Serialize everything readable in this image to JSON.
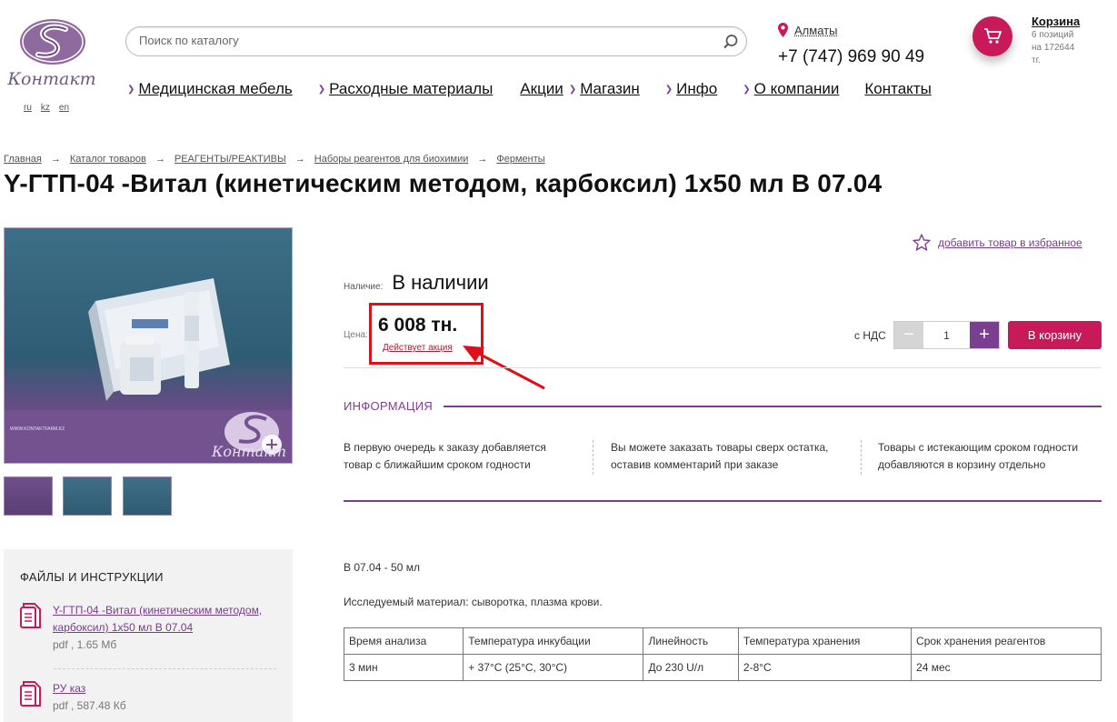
{
  "brand": {
    "logo_text": "Контакт",
    "accent": "#7b3f8f",
    "pink": "#c8195a"
  },
  "langs": [
    "ru",
    "kz",
    "en"
  ],
  "search": {
    "placeholder": "Поиск по каталогу",
    "icon": "search-icon"
  },
  "city": "Алматы",
  "phone": "+7 (747) 969 90 49",
  "cart": {
    "title": "Корзина",
    "line1": "6 позиций",
    "line2": "на 172644",
    "line3": "тг."
  },
  "nav": [
    {
      "label": "Медицинская мебель",
      "chevron": true
    },
    {
      "label": "Расходные материалы",
      "chevron": true
    },
    {
      "label": "Акции",
      "chevron": false
    },
    {
      "label": "Магазин",
      "chevron": true
    },
    {
      "label": "Инфо",
      "chevron": true
    },
    {
      "label": "О компании",
      "chevron": true
    },
    {
      "label": "Контакты",
      "chevron": false
    }
  ],
  "breadcrumbs": [
    "Главная",
    "Каталог товаров",
    "РЕАГЕНТЫ/РЕАКТИВЫ",
    "Наборы реагентов для биохимии",
    "Ферменты"
  ],
  "product": {
    "title": "Y-ГТП-04 -Витал (кинетическим методом, карбоксил) 1x50 мл В 07.04",
    "favorite": "добавить товар в избранное",
    "availability_label": "Наличие:",
    "availability": "В наличии",
    "price_label": "Цена:",
    "price": "6 008 тн.",
    "promo": "Действует акция",
    "vat": "с НДС",
    "qty": "1",
    "minus": "−",
    "plus": "+",
    "buy": "В корзину"
  },
  "info": {
    "heading": "ИНФОРМАЦИЯ",
    "notes": [
      {
        "l1": "В первую очередь к заказу добавляется",
        "l2": "товар с ближайшим сроком годности"
      },
      {
        "l1": "Вы можете заказать товары сверх остатка,",
        "l2": "оставив комментарий при заказе"
      },
      {
        "l1": "Товары с истекающим сроком годности",
        "l2": "добавляются в корзину отдельно"
      }
    ]
  },
  "description": {
    "line1": "В 07.04 - 50 мл",
    "line2": "Исследуемый материал: сыворотка, плазма крови."
  },
  "spec_table": {
    "headers": [
      "Время анализа",
      "Температура инкубации",
      "Линейность",
      "Температура хранения",
      "Срок хранения реагентов"
    ],
    "row": [
      "3 мин",
      "+ 37°С (25°С, 30°С)",
      "До 230 U/л",
      "2-8°С",
      "24 мес"
    ]
  },
  "files": {
    "heading": "ФАЙЛЫ И ИНСТРУКЦИИ",
    "items": [
      {
        "name": "Y-ГТП-04 -Витал (кинетическим методом, карбоксил) 1x50 мл В 07.04",
        "meta": "pdf , 1.65 Мб"
      },
      {
        "name": "РУ каз",
        "meta": "pdf , 587.48 Кб"
      }
    ]
  },
  "image": {
    "watermark": "WWW.KONTAKTFARM.KZ",
    "logo_text": "Контакт"
  }
}
